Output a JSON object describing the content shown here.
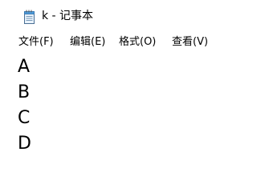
{
  "window": {
    "title": "k - 记事本",
    "app_icon": "notepad-icon"
  },
  "menu": {
    "items": [
      {
        "label": "文件(F)"
      },
      {
        "label": "编辑(E)"
      },
      {
        "label": "格式(O)"
      },
      {
        "label": "查看(V)"
      }
    ]
  },
  "editor": {
    "lines": [
      "A",
      "B",
      "C",
      "D"
    ]
  },
  "colors": {
    "background": "#ffffff",
    "text": "#000000"
  }
}
